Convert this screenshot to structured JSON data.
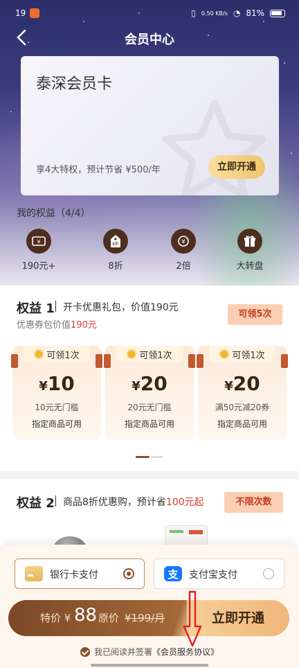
{
  "status_bar": {
    "left_text": "19",
    "network_speed": "0.50 KB/s",
    "battery": "81%"
  },
  "nav": {
    "title": "会员中心"
  },
  "card": {
    "title": "泰深会员卡",
    "description": "享4大特权，预计节省 ¥500/年",
    "button": "立即开通"
  },
  "rights": {
    "title": "我的权益（4/4）",
    "items": [
      {
        "label": "190元+",
        "icon": "coupon-icon"
      },
      {
        "label": "8折",
        "icon": "discount-tag-icon"
      },
      {
        "label": "2倍",
        "icon": "coin-multiplier-icon"
      },
      {
        "label": "大转盘",
        "icon": "gift-box-icon"
      }
    ]
  },
  "benefit1": {
    "title": "权益 1",
    "description": "开卡优惠礼包，价值190元",
    "sub_prefix": "优惠券包价值",
    "sub_value": "190元",
    "tag": "可领5次",
    "coupons": [
      {
        "claim": "可领1次",
        "amount": "10",
        "condition": "10元无门槛",
        "scope": "指定商品可用"
      },
      {
        "claim": "可领1次",
        "amount": "20",
        "condition": "20元无门槛",
        "scope": "指定商品可用"
      },
      {
        "claim": "可领1次",
        "amount": "20",
        "condition": "满50元减20券",
        "scope": "指定商品可用"
      }
    ],
    "currency_symbol": "¥"
  },
  "benefit2": {
    "title": "权益 2",
    "description_prefix": "商品8折优惠购，预计省",
    "description_value": "100元起",
    "tag": "不限次数"
  },
  "payment": {
    "options": [
      {
        "label": "银行卡支付",
        "selected": true
      },
      {
        "label": "支付宝支付",
        "selected": false
      }
    ],
    "buy": {
      "promo_label": "特价 ¥",
      "promo_price": "88",
      "orig_label": "原价",
      "orig_price": "¥199/月",
      "button": "立即开通"
    },
    "agreement_prefix": "我已阅读并签署",
    "agreement_link": "《会员服务协议》"
  },
  "colors": {
    "accent_brown": "#8a4e2b",
    "tag_red": "#c2391f",
    "price_red": "#d43a2a"
  }
}
